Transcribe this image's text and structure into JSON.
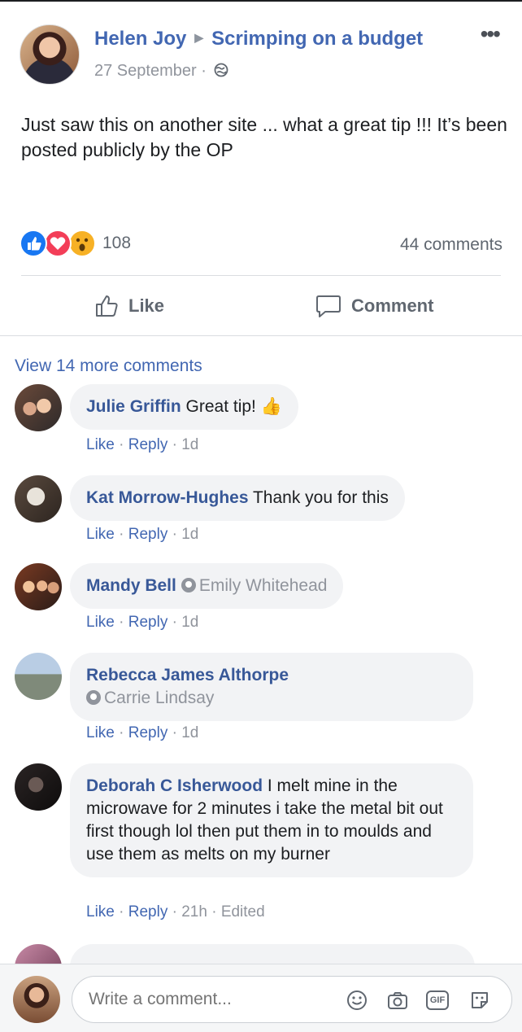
{
  "post": {
    "author": "Helen Joy",
    "group": "Scrimping on a budget",
    "date": "27 September",
    "meta_sep": " · ",
    "text": "Just saw this on another site ... what a great tip !!! It’s been posted publicly by the OP",
    "reaction_count": "108",
    "comments_count": "44 comments",
    "reactions": [
      "like-reaction-icon",
      "love-reaction-icon",
      "wow-reaction-icon"
    ]
  },
  "actions": {
    "like": "Like",
    "comment": "Comment"
  },
  "view_more": "View 14 more comments",
  "comments": [
    {
      "name": "Julie Griffin",
      "text": " Great tip! 👍",
      "like": "Like",
      "reply": "Reply",
      "time": "1d"
    },
    {
      "name": "Kat Morrow-Hughes",
      "text": " Thank you for this",
      "like": "Like",
      "reply": "Reply",
      "time": "1d"
    },
    {
      "name": "Mandy Bell",
      "tagged": "Emily Whitehead",
      "like": "Like",
      "reply": "Reply",
      "time": "1d"
    },
    {
      "name": "Rebecca James Althorpe",
      "tagged": "Carrie Lindsay",
      "like": "Like",
      "reply": "Reply",
      "time": "1d"
    },
    {
      "name": "Deborah C Isherwood",
      "text": " I melt mine in the microwave for 2 minutes i take the metal bit out first though lol then put them in to moulds and use them as melts on my burner",
      "like": "Like",
      "reply": "Reply",
      "time": "21h",
      "edited": "Edited"
    }
  ],
  "composer": {
    "placeholder": "Write a comment...",
    "tools": [
      "emoji-icon",
      "camera-icon",
      "gif-icon",
      "sticker-icon"
    ],
    "gif_label": "GIF"
  },
  "colors": {
    "link": "#4267b2",
    "name": "#385898",
    "meta": "#90949c",
    "bubble": "#f2f3f5"
  }
}
